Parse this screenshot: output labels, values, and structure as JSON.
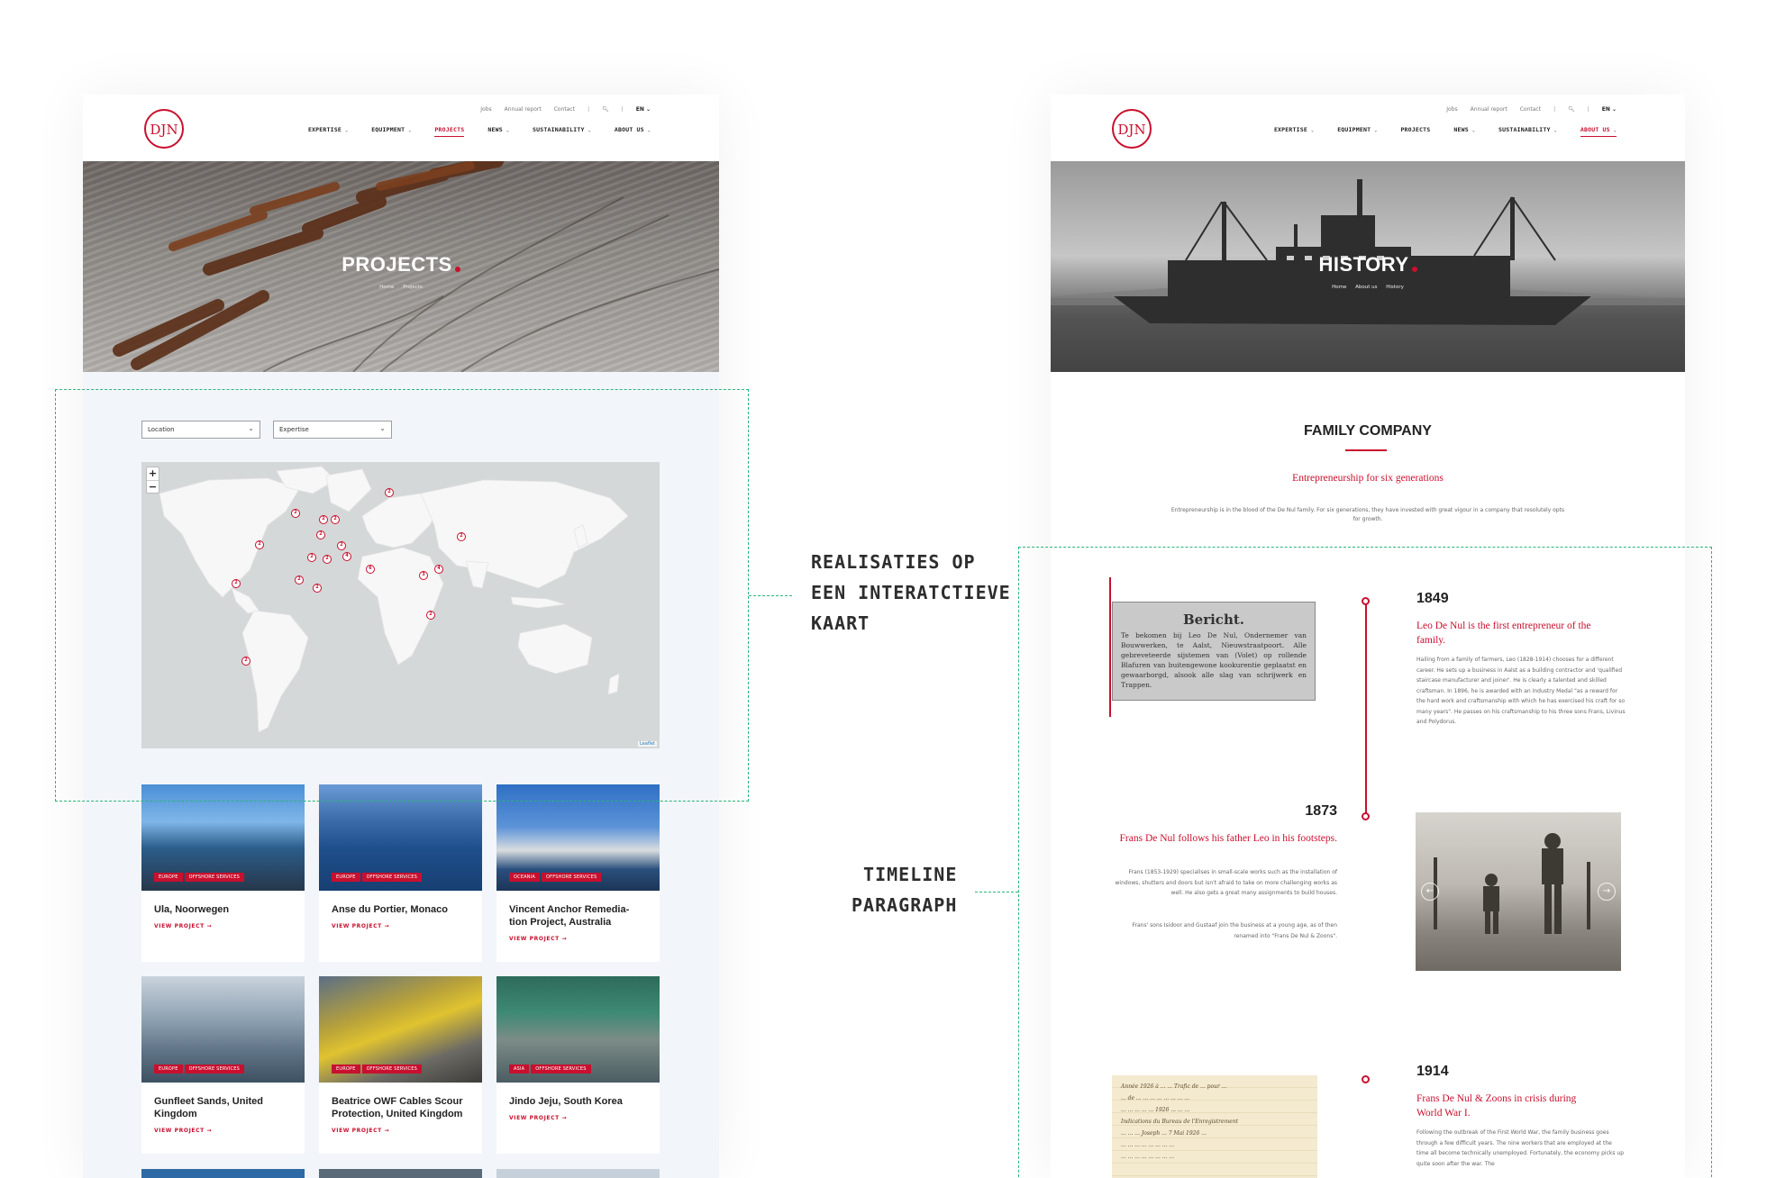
{
  "left_page": {
    "topbar": {
      "jobs": "Jobs",
      "annual_report": "Annual report",
      "contact": "Contact",
      "language": "EN"
    },
    "nav": [
      "EXPERTISE",
      "EQUIPMENT",
      "PROJECTS",
      "NEWS",
      "SUSTAINABILITY",
      "ABOUT US"
    ],
    "active_nav": "PROJECTS",
    "hero": {
      "title": "PROJECTS",
      "crumb_home": "Home",
      "crumb_current": "Projects"
    },
    "filters": {
      "location": "Location",
      "expertise": "Expertise"
    },
    "map": {
      "zoom_in": "+",
      "zoom_out": "−",
      "attribution": "Leaflet",
      "markers": [
        "2",
        "2",
        "2",
        "2",
        "2",
        "2",
        "2",
        "2",
        "2",
        "2",
        "4",
        "6",
        "4",
        "2",
        "3",
        "2",
        "2",
        "2",
        "2"
      ]
    },
    "projects": [
      {
        "title": "Ula, Noorwegen",
        "region": "EUROPE",
        "service": "OFFSHORE SERVICES",
        "view": "VIEW PROJECT"
      },
      {
        "title": "Anse du Portier, Monaco",
        "region": "EUROPE",
        "service": "OFFSHORE SERVICES",
        "view": "VIEW PROJECT"
      },
      {
        "title": "Vincent Anchor Remedia-tion Project, Australia",
        "region": "OCEANIA",
        "service": "OFFSHORE SERVICES",
        "view": "VIEW PROJECT"
      },
      {
        "title": "Gunfleet Sands, United Kingdom",
        "region": "EUROPE",
        "service": "OFFSHORE SERVICES",
        "view": "VIEW PROJECT"
      },
      {
        "title": "Beatrice OWF Cables Scour Protection, United Kingdom",
        "region": "EUROPE",
        "service": "OFFSHORE SERVICES",
        "view": "VIEW PROJECT"
      },
      {
        "title": "Jindo Jeju, South Korea",
        "region": "ASIA",
        "service": "OFFSHORE SERVICES",
        "view": "VIEW PROJECT"
      }
    ]
  },
  "right_page": {
    "topbar": {
      "jobs": "Jobs",
      "annual_report": "Annual report",
      "contact": "Contact",
      "language": "EN"
    },
    "nav": [
      "EXPERTISE",
      "EQUIPMENT",
      "PROJECTS",
      "NEWS",
      "SUSTAINABILITY",
      "ABOUT US"
    ],
    "active_nav": "ABOUT US",
    "hero": {
      "title": "HISTORY",
      "crumb_home": "Home",
      "crumb_parent": "About us",
      "crumb_current": "History"
    },
    "section_title": "FAMILY COMPANY",
    "section_subtitle": "Entrepreneurship for six generations",
    "section_intro": "Entrepreneurship is in the blood of the De Nul family. For six generations, they have invested with great vigour in a company that resolutely opts for growth.",
    "newsprint": {
      "title": "Bericht.",
      "body": "Te bekomen bij Leo De Nul, Ondernemer van Bouwwerken, te Aalst, Nieuwstraatpoort. Alle gebreveteerde sijstemen van (Volet) op rollende Blafuren van buitengewone kookurentie geplaatst en gewaarborgd, alsook alle slag van schrijwerk en Trappen."
    },
    "timeline": [
      {
        "year": "1849",
        "heading": "Leo De Nul is the first entrepreneur of the family.",
        "text": "Hailing from a family of farmers, Leo (1828-1914) chooses for a different career. He sets up a business in Aalst as a building contractor and 'qualified staircase manufacturer and joiner'. He is clearly a talented and skilled craftsman. In 1896, he is awarded with an Industry Medal \"as a reward for the hard work and craftsmanship with which he has exercised his craft for so many years\". He passes on his craftsmanship to his three sons Frans, Livinus and Polydorus."
      },
      {
        "year": "1873",
        "heading": "Frans De Nul follows his father Leo in his footsteps.",
        "text": "Frans (1853-1929) specialises in small-scale works such as the installation of windows, shutters and doors but isn't afraid to take on more challenging works as well. He also gets a great many assignments to build houses.",
        "text2": "Frans' sons Isidoor and Gustaaf join the business at a young age, as of then renamed into \"Frans De Nul & Zoons\"."
      },
      {
        "year": "1914",
        "heading": "Frans De Nul & Zoons in crisis during World War I.",
        "text": "Following the outbreak of the First World War, the family business goes through a few difficult years. The nine workers that are employed at the time all become technically unemployed. Fortunately, the economy picks up quite soon after the war. The"
      }
    ],
    "letter_lines": [
      "Année 1926 à ... ... Trafic de ... pour ...",
      "... de ... ... ... ... ... ... ... ...",
      "... ... ... ... ... 1926 ... ... ...",
      "Indications du Bureau de l'Enregistrement",
      "... ... ... Joseph ... 7 Mai 1926 ...",
      "... ... ... ... ... ... ... ...",
      "... ... ... ... ... ... ... ..."
    ]
  },
  "annotations": {
    "map": [
      "REALISATIES OP",
      "EEN INTERATCTIEVE",
      "KAART"
    ],
    "timeline": [
      "TIMELINE",
      "PARAGRAPH"
    ]
  },
  "colors": {
    "brand_red": "#c8102e",
    "annotation_green": "#2bb57a",
    "page_bg": "#f2f5f9"
  },
  "icons": [
    "logo-djn",
    "search-icon",
    "chevron-down-icon",
    "arrow-right-icon",
    "plus-icon",
    "minus-icon",
    "arrow-left-icon"
  ]
}
